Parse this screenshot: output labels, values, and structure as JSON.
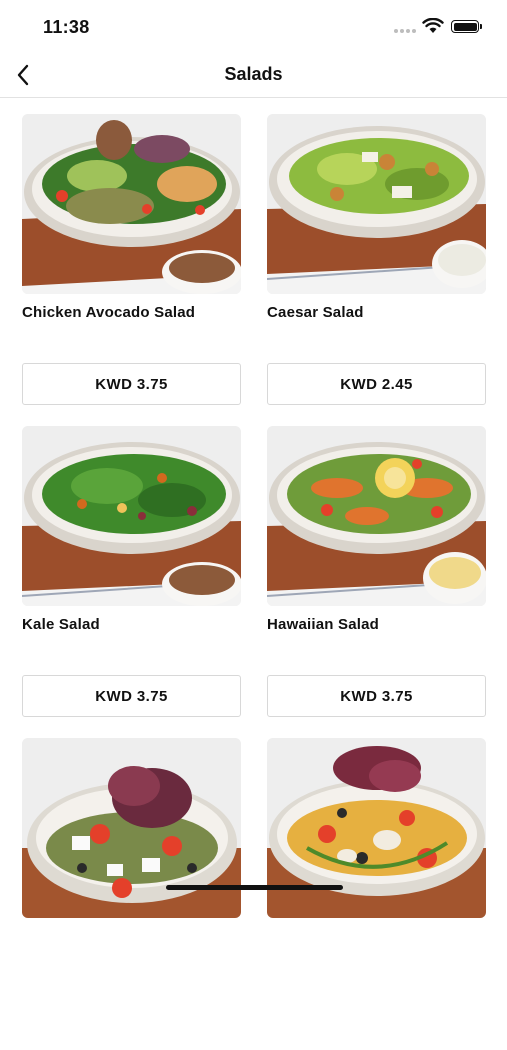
{
  "status_bar": {
    "time": "11:38"
  },
  "nav": {
    "title": "Salads"
  },
  "products": [
    {
      "name": "Chicken Avocado Salad",
      "price": "KWD 3.75",
      "image_icon": "chicken-avocado-salad-image"
    },
    {
      "name": "Caesar Salad",
      "price": "KWD 2.45",
      "image_icon": "caesar-salad-image"
    },
    {
      "name": "Kale Salad",
      "price": "KWD 3.75",
      "image_icon": "kale-salad-image"
    },
    {
      "name": "Hawaiian Salad",
      "price": "KWD 3.75",
      "image_icon": "hawaiian-salad-image"
    },
    {
      "name": "",
      "price": "",
      "image_icon": "greek-quinoa-salad-image"
    },
    {
      "name": "",
      "price": "",
      "image_icon": "pasta-salad-image"
    }
  ],
  "colors": {
    "background": "#ffffff",
    "text": "#111111",
    "divider": "#e2e2e2",
    "button_border": "#d8d8d8"
  }
}
